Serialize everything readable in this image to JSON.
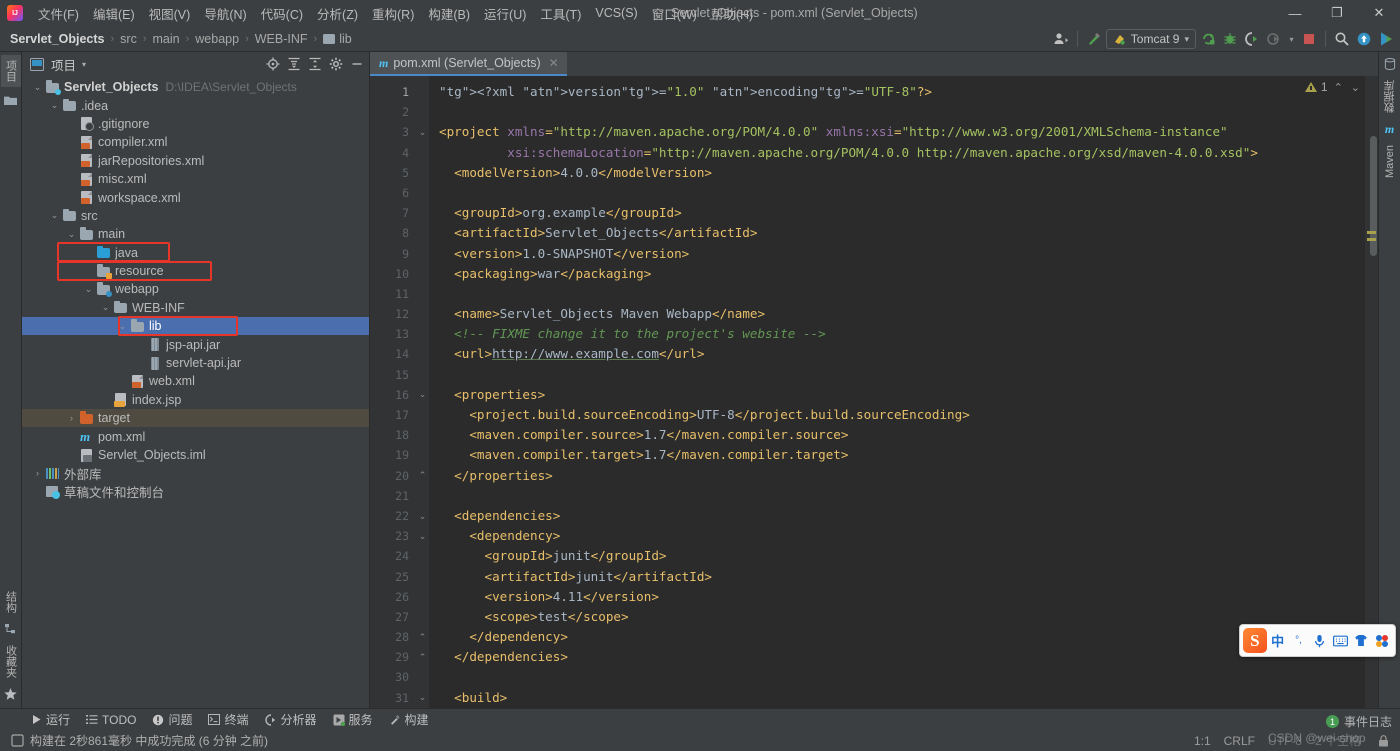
{
  "window": {
    "title": "Servlet_Objects - pom.xml (Servlet_Objects)",
    "minimize": "—",
    "maximize": "❐",
    "close": "✕"
  },
  "menubar": {
    "items": [
      {
        "label": "文件(F)",
        "name": "menu-file"
      },
      {
        "label": "编辑(E)",
        "name": "menu-edit"
      },
      {
        "label": "视图(V)",
        "name": "menu-view"
      },
      {
        "label": "导航(N)",
        "name": "menu-navigate"
      },
      {
        "label": "代码(C)",
        "name": "menu-code"
      },
      {
        "label": "分析(Z)",
        "name": "menu-analyze"
      },
      {
        "label": "重构(R)",
        "name": "menu-refactor"
      },
      {
        "label": "构建(B)",
        "name": "menu-build"
      },
      {
        "label": "运行(U)",
        "name": "menu-run"
      },
      {
        "label": "工具(T)",
        "name": "menu-tools"
      },
      {
        "label": "VCS(S)",
        "name": "menu-vcs"
      },
      {
        "label": "窗口(W)",
        "name": "menu-window"
      },
      {
        "label": "帮助(H)",
        "name": "menu-help"
      }
    ]
  },
  "breadcrumb": {
    "items": [
      "Servlet_Objects",
      "src",
      "main",
      "webapp",
      "WEB-INF",
      "lib"
    ],
    "separator": "›"
  },
  "toolbar": {
    "run_config": "Tomcat 9",
    "dropdown_caret": "▾",
    "icons": [
      "user-avatar-icon",
      "build-hammer-icon",
      "run-icon",
      "debug-icon",
      "run-coverage-icon",
      "profile-icon",
      "stop-icon",
      "search-everywhere-icon",
      "update-project-icon",
      "play-icon"
    ]
  },
  "left_toolwindows": {
    "top": [
      "项目"
    ],
    "bottom": [
      "结构",
      "收藏夹"
    ]
  },
  "right_toolwindows": {
    "top": [
      "数据库",
      "Maven"
    ]
  },
  "project_panel": {
    "title": "项目",
    "caret": "▾",
    "header_icons": [
      "locate-icon",
      "expand-all-icon",
      "collapse-all-icon",
      "settings-gear-icon",
      "hide-icon"
    ],
    "tree": [
      {
        "label": "Servlet_Objects",
        "path": "D:\\IDEA\\Servlet_Objects",
        "icon": "module-folder-icon",
        "indent": 0,
        "arrow": "v",
        "bold": true,
        "state": "normal"
      },
      {
        "label": ".idea",
        "icon": "folder-icon",
        "indent": 1,
        "arrow": "v",
        "state": "normal"
      },
      {
        "label": ".gitignore",
        "icon": "gitignore-file-icon",
        "indent": 2,
        "arrow": "",
        "state": "normal"
      },
      {
        "label": "compiler.xml",
        "icon": "xml-file-icon",
        "indent": 2,
        "arrow": "",
        "state": "normal"
      },
      {
        "label": "jarRepositories.xml",
        "icon": "xml-file-icon",
        "indent": 2,
        "arrow": "",
        "state": "normal"
      },
      {
        "label": "misc.xml",
        "icon": "xml-file-icon",
        "indent": 2,
        "arrow": "",
        "state": "normal"
      },
      {
        "label": "workspace.xml",
        "icon": "xml-file-icon",
        "indent": 2,
        "arrow": "",
        "state": "normal"
      },
      {
        "label": "src",
        "icon": "folder-icon",
        "indent": 1,
        "arrow": "v",
        "state": "normal"
      },
      {
        "label": "main",
        "icon": "folder-icon",
        "indent": 2,
        "arrow": "v",
        "state": "normal"
      },
      {
        "label": "java",
        "icon": "source-root-folder-icon",
        "indent": 3,
        "arrow": "",
        "state": "highlighted"
      },
      {
        "label": "resource",
        "icon": "resource-root-folder-icon",
        "indent": 3,
        "arrow": "",
        "state": "highlighted"
      },
      {
        "label": "webapp",
        "icon": "webapp-folder-icon",
        "indent": 3,
        "arrow": "v",
        "state": "normal"
      },
      {
        "label": "WEB-INF",
        "icon": "folder-icon",
        "indent": 4,
        "arrow": "v",
        "state": "normal"
      },
      {
        "label": "lib",
        "icon": "folder-icon",
        "indent": 5,
        "arrow": "v",
        "state": "selected-highlighted"
      },
      {
        "label": "jsp-api.jar",
        "icon": "jar-file-icon",
        "indent": 6,
        "arrow": "",
        "state": "normal"
      },
      {
        "label": "servlet-api.jar",
        "icon": "jar-file-icon",
        "indent": 6,
        "arrow": "",
        "state": "normal"
      },
      {
        "label": "web.xml",
        "icon": "xml-file-icon",
        "indent": 5,
        "arrow": "",
        "state": "normal"
      },
      {
        "label": "index.jsp",
        "icon": "jsp-file-icon",
        "indent": 4,
        "arrow": "",
        "state": "normal"
      },
      {
        "label": "target",
        "icon": "excluded-folder-icon",
        "indent": 2,
        "arrow": ">",
        "state": "excluded"
      },
      {
        "label": "pom.xml",
        "icon": "maven-file-icon",
        "indent": 2,
        "arrow": "",
        "state": "normal"
      },
      {
        "label": "Servlet_Objects.iml",
        "icon": "iml-file-icon",
        "indent": 2,
        "arrow": "",
        "state": "normal"
      },
      {
        "label": "外部库",
        "icon": "external-libraries-icon",
        "indent": 0,
        "arrow": ">",
        "state": "normal"
      },
      {
        "label": "草稿文件和控制台",
        "icon": "scratches-icon",
        "indent": 0,
        "arrow": "",
        "state": "normal"
      }
    ]
  },
  "editor": {
    "tab": {
      "label": "pom.xml (Servlet_Objects)",
      "icon": "maven-file-icon",
      "close": "✕"
    },
    "inspection": {
      "warnings": "1",
      "prev": "⌃",
      "next": "⌄"
    },
    "lines": [
      {
        "n": 1,
        "fold": ""
      },
      {
        "n": 2,
        "fold": ""
      },
      {
        "n": 3,
        "fold": "v"
      },
      {
        "n": 4,
        "fold": ""
      },
      {
        "n": 5,
        "fold": ""
      },
      {
        "n": 6,
        "fold": ""
      },
      {
        "n": 7,
        "fold": ""
      },
      {
        "n": 8,
        "fold": ""
      },
      {
        "n": 9,
        "fold": ""
      },
      {
        "n": 10,
        "fold": ""
      },
      {
        "n": 11,
        "fold": ""
      },
      {
        "n": 12,
        "fold": ""
      },
      {
        "n": 13,
        "fold": ""
      },
      {
        "n": 14,
        "fold": ""
      },
      {
        "n": 15,
        "fold": ""
      },
      {
        "n": 16,
        "fold": "v"
      },
      {
        "n": 17,
        "fold": ""
      },
      {
        "n": 18,
        "fold": ""
      },
      {
        "n": 19,
        "fold": ""
      },
      {
        "n": 20,
        "fold": "^"
      },
      {
        "n": 21,
        "fold": ""
      },
      {
        "n": 22,
        "fold": "v"
      },
      {
        "n": 23,
        "fold": "v"
      },
      {
        "n": 24,
        "fold": ""
      },
      {
        "n": 25,
        "fold": ""
      },
      {
        "n": 26,
        "fold": ""
      },
      {
        "n": 27,
        "fold": ""
      },
      {
        "n": 28,
        "fold": "^"
      },
      {
        "n": 29,
        "fold": "^"
      },
      {
        "n": 30,
        "fold": ""
      },
      {
        "n": 31,
        "fold": "v"
      }
    ],
    "source_text": [
      "<?xml version=\"1.0\" encoding=\"UTF-8\"?>",
      "",
      "<project xmlns=\"http://maven.apache.org/POM/4.0.0\" xmlns:xsi=\"http://www.w3.org/2001/XMLSchema-instance\"",
      "         xsi:schemaLocation=\"http://maven.apache.org/POM/4.0.0 http://maven.apache.org/xsd/maven-4.0.0.xsd\">",
      "  <modelVersion>4.0.0</modelVersion>",
      "",
      "  <groupId>org.example</groupId>",
      "  <artifactId>Servlet_Objects</artifactId>",
      "  <version>1.0-SNAPSHOT</version>",
      "  <packaging>war</packaging>",
      "",
      "  <name>Servlet_Objects Maven Webapp</name>",
      "  <!-- FIXME change it to the project's website -->",
      "  <url>http://www.example.com</url>",
      "",
      "  <properties>",
      "    <project.build.sourceEncoding>UTF-8</project.build.sourceEncoding>",
      "    <maven.compiler.source>1.7</maven.compiler.source>",
      "    <maven.compiler.target>1.7</maven.compiler.target>",
      "  </properties>",
      "",
      "  <dependencies>",
      "    <dependency>",
      "      <groupId>junit</groupId>",
      "      <artifactId>junit</artifactId>",
      "      <version>4.11</version>",
      "      <scope>test</scope>",
      "    </dependency>",
      "  </dependencies>",
      "",
      "  <build>"
    ]
  },
  "bottom_toolbar": {
    "items": [
      {
        "label": "运行",
        "icon": "run-triangle-icon"
      },
      {
        "label": "TODO",
        "icon": "todo-list-icon"
      },
      {
        "label": "问题",
        "icon": "problems-icon"
      },
      {
        "label": "终端",
        "icon": "terminal-icon"
      },
      {
        "label": "分析器",
        "icon": "profiler-icon"
      },
      {
        "label": "服务",
        "icon": "services-icon"
      },
      {
        "label": "构建",
        "icon": "build-hammer-icon"
      }
    ]
  },
  "status": {
    "message": "构建在 2秒861毫秒 中成功完成 (6 分钟 之前)",
    "message_icon": "build-status-icon",
    "event_log": {
      "label": "事件日志",
      "count": "1"
    },
    "caret": "1:1",
    "line_separator": "CRLF",
    "encoding": "UTF-8",
    "indent": "2 个空格",
    "lock_icon": "read-only-lock-icon"
  },
  "ime": {
    "logo": "S",
    "buttons": [
      "中",
      "°,",
      "microphone-icon",
      "keyboard-icon",
      "skin-icon",
      "apps-icon"
    ]
  },
  "watermark": {
    "text": "CSDN @wei-shop"
  },
  "colors": {
    "accent_blue": "#4b6eaf",
    "highlight_red": "#e8352a",
    "tag_orange": "#e8bf6a",
    "comment_green": "#629755",
    "string_green": "#a5c261",
    "bg_editor": "#2b2b2b",
    "bg_panel": "#3c3f41"
  }
}
